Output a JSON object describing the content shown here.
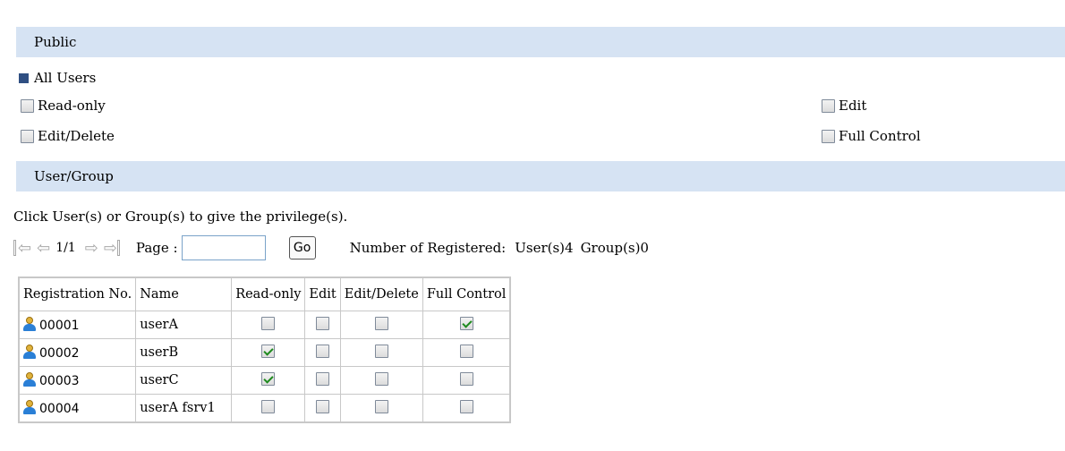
{
  "public_section": {
    "title": "Public"
  },
  "all_users": {
    "label": "All Users"
  },
  "public_perms": {
    "read_only": {
      "label": "Read-only",
      "checked": false
    },
    "edit": {
      "label": "Edit",
      "checked": false
    },
    "edit_delete": {
      "label": "Edit/Delete",
      "checked": false
    },
    "full_control": {
      "label": "Full Control",
      "checked": false
    }
  },
  "user_group_section": {
    "title": "User/Group"
  },
  "instruction": "Click User(s) or Group(s) to give the privilege(s).",
  "pager": {
    "page_indicator": "1/1",
    "page_label": "Page :",
    "page_value": "",
    "go_label": "Go",
    "registered_label": "Number of Registered:",
    "users_count": "User(s)4",
    "groups_count": "Group(s)0"
  },
  "table": {
    "headers": [
      "Registration No.",
      "Name",
      "Read-only",
      "Edit",
      "Edit/Delete",
      "Full Control"
    ],
    "rows": [
      {
        "reg_no": "00001",
        "name": "userA",
        "read_only": false,
        "edit": false,
        "edit_delete": false,
        "full_control": true
      },
      {
        "reg_no": "00002",
        "name": "userB",
        "read_only": true,
        "edit": false,
        "edit_delete": false,
        "full_control": false
      },
      {
        "reg_no": "00003",
        "name": "userC",
        "read_only": true,
        "edit": false,
        "edit_delete": false,
        "full_control": false
      },
      {
        "reg_no": "00004",
        "name": "userA fsrv1",
        "read_only": false,
        "edit": false,
        "edit_delete": false,
        "full_control": false
      }
    ]
  },
  "colors": {
    "section_bg": "#d6e3f3",
    "check": "#1e8a1e",
    "bullet": "#2f4f82"
  }
}
